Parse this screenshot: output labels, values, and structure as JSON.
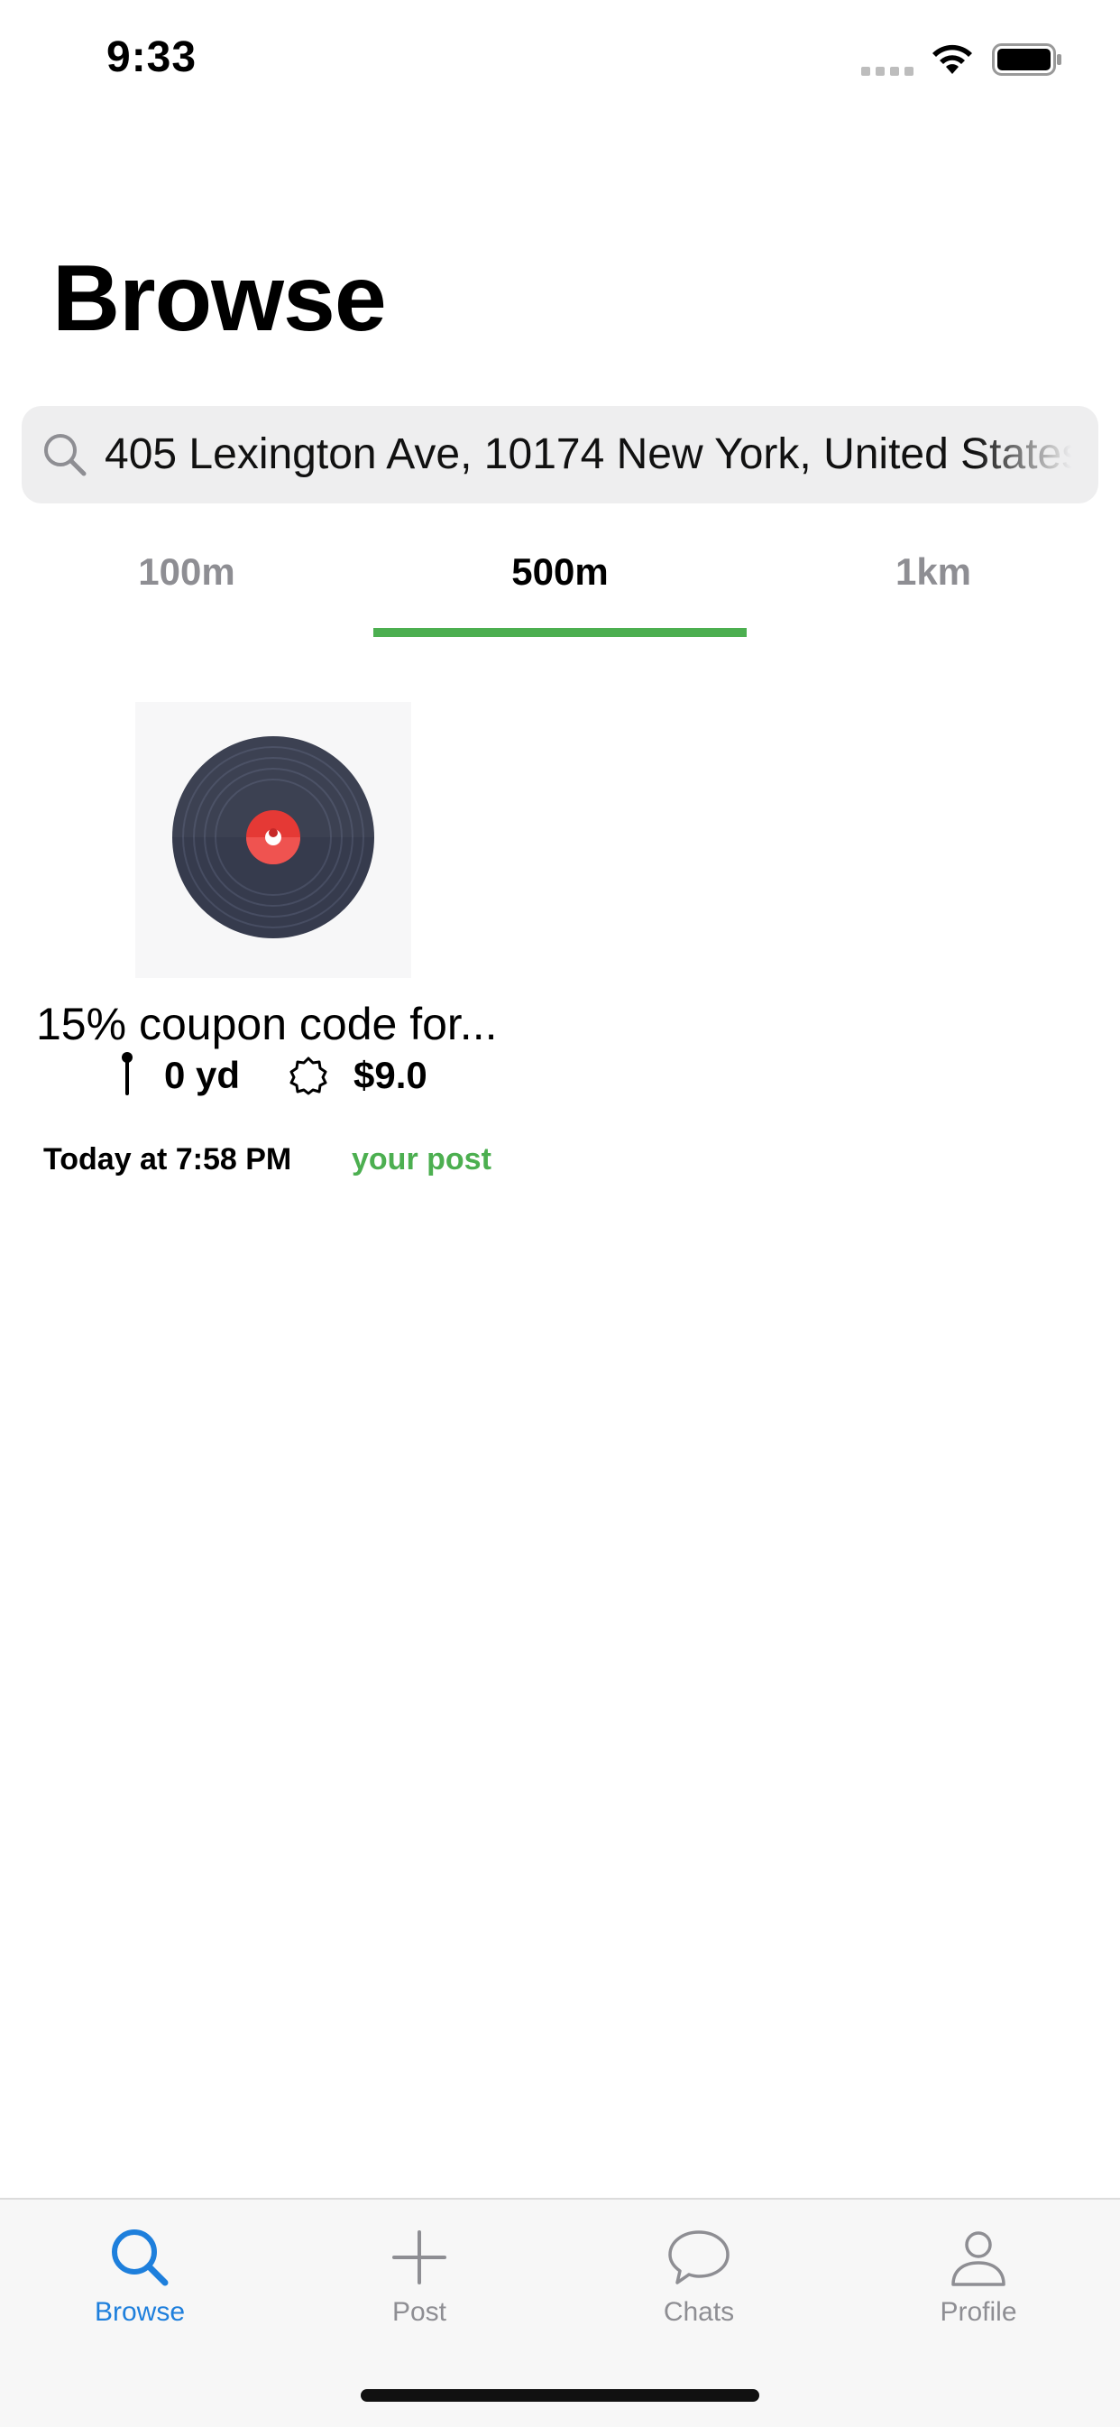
{
  "status_bar": {
    "time": "9:33"
  },
  "header": {
    "title": "Browse"
  },
  "search": {
    "value": "405 Lexington Ave, 10174 New York, United States"
  },
  "distance_tabs": [
    {
      "label": "100m",
      "active": false
    },
    {
      "label": "500m",
      "active": true
    },
    {
      "label": "1km",
      "active": false
    }
  ],
  "posts": [
    {
      "title": "15% coupon code for...",
      "distance": "0 yd",
      "price": "$9.0",
      "time": "Today at 7:58 PM",
      "owner_tag": "your post",
      "image_icon": "vinyl-record"
    }
  ],
  "tab_bar": {
    "items": [
      {
        "label": "Browse",
        "icon": "search-icon",
        "active": true
      },
      {
        "label": "Post",
        "icon": "plus-icon",
        "active": false
      },
      {
        "label": "Chats",
        "icon": "chat-bubble-icon",
        "active": false
      },
      {
        "label": "Profile",
        "icon": "person-icon",
        "active": false
      }
    ]
  },
  "colors": {
    "accent_green": "#4caf50",
    "tab_active_blue": "#1e7fdc",
    "inactive_gray": "#8e8e93"
  }
}
